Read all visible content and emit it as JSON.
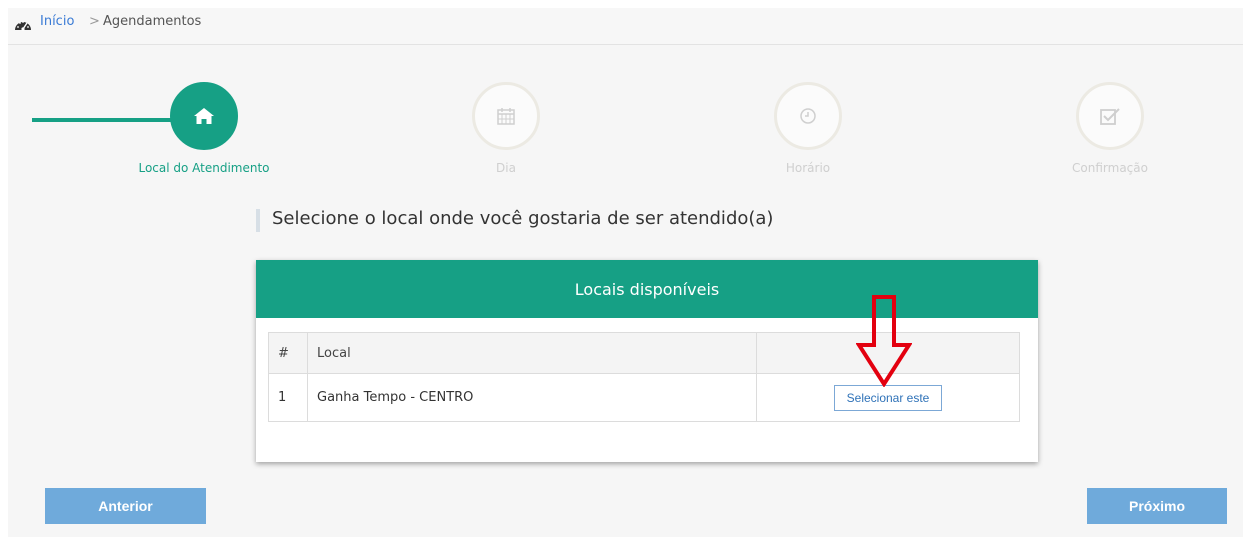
{
  "breadcrumb": {
    "home": "Início",
    "separator": ">",
    "current": "Agendamentos"
  },
  "steps": [
    {
      "label": "Local do Atendimento",
      "icon": "home-icon",
      "active": true
    },
    {
      "label": "Dia",
      "icon": "calendar-icon",
      "active": false
    },
    {
      "label": "Horário",
      "icon": "clock-icon",
      "active": false
    },
    {
      "label": "Confirmação",
      "icon": "check-square-icon",
      "active": false
    }
  ],
  "prompt": "Selecione o local onde você gostaria de ser atendido(a)",
  "panel": {
    "title": "Locais disponíveis",
    "headers": [
      "#",
      "Local",
      ""
    ],
    "rows": [
      {
        "num": "1",
        "local": "Ganha Tempo - CENTRO",
        "action": "Selecionar este"
      }
    ]
  },
  "buttons": {
    "previous": "Anterior",
    "next": "Próximo"
  },
  "colors": {
    "accent": "#16a085",
    "button": "#6faadb",
    "link": "#3a7bd5",
    "annotation_arrow": "#e3000f"
  }
}
